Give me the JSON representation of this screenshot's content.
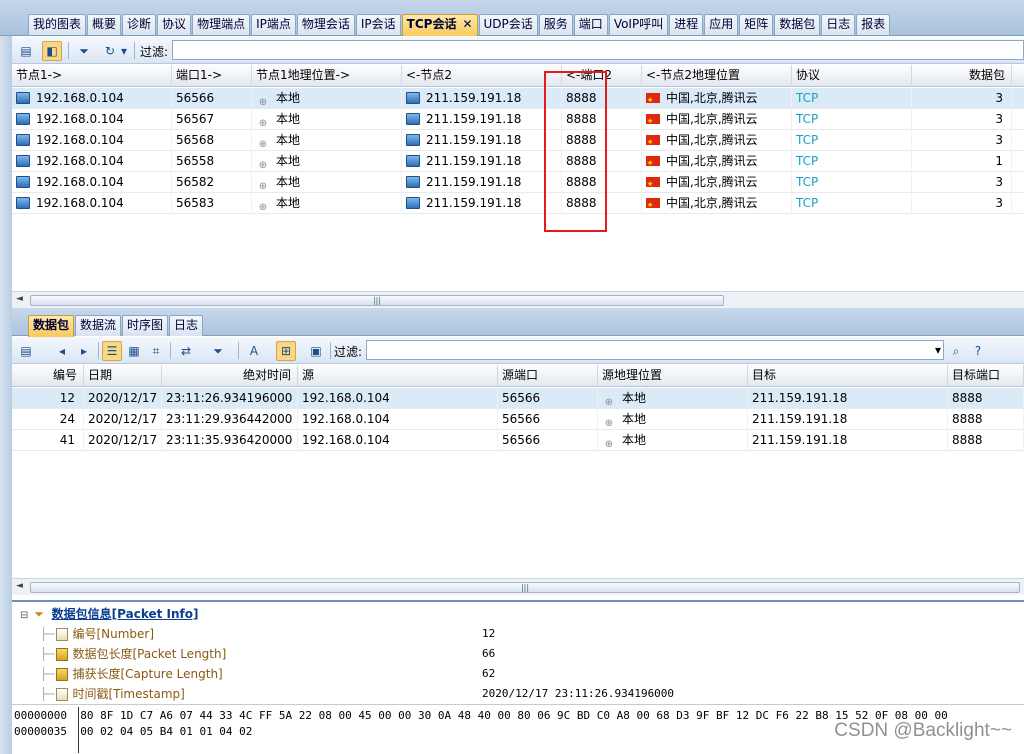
{
  "top_tabs": [
    "我的图表",
    "概要",
    "诊断",
    "协议",
    "物理端点",
    "IP端点",
    "物理会话",
    "IP会话",
    "TCP会话",
    "UDP会话",
    "服务",
    "端口",
    "VoIP呼叫",
    "进程",
    "应用",
    "矩阵",
    "数据包",
    "日志",
    "报表"
  ],
  "active_top_tab": "TCP会话",
  "close_glyph": "✕",
  "toolbar1": {
    "filter_label": "过滤:",
    "filter_value": ""
  },
  "sessions": {
    "headers": [
      "节点1->",
      "端口1->",
      "节点1地理位置->",
      "<-节点2",
      "<-端口2",
      "<-节点2地理位置",
      "协议",
      "数据包"
    ],
    "rows": [
      [
        "192.168.0.104",
        "56566",
        "本地",
        "211.159.191.18",
        "8888",
        "中国,北京,腾讯云",
        "TCP",
        "3"
      ],
      [
        "192.168.0.104",
        "56567",
        "本地",
        "211.159.191.18",
        "8888",
        "中国,北京,腾讯云",
        "TCP",
        "3"
      ],
      [
        "192.168.0.104",
        "56568",
        "本地",
        "211.159.191.18",
        "8888",
        "中国,北京,腾讯云",
        "TCP",
        "3"
      ],
      [
        "192.168.0.104",
        "56558",
        "本地",
        "211.159.191.18",
        "8888",
        "中国,北京,腾讯云",
        "TCP",
        "1"
      ],
      [
        "192.168.0.104",
        "56582",
        "本地",
        "211.159.191.18",
        "8888",
        "中国,北京,腾讯云",
        "TCP",
        "3"
      ],
      [
        "192.168.0.104",
        "56583",
        "本地",
        "211.159.191.18",
        "8888",
        "中国,北京,腾讯云",
        "TCP",
        "3"
      ]
    ]
  },
  "sub_tabs": [
    "数据包",
    "数据流",
    "时序图",
    "日志"
  ],
  "active_sub_tab": "数据包",
  "toolbar2": {
    "filter_label": "过滤:",
    "filter_value": ""
  },
  "packets": {
    "headers": [
      "编号",
      "日期",
      "绝对时间",
      "源",
      "源端口",
      "源地理位置",
      "目标",
      "目标端口"
    ],
    "rows": [
      [
        "12",
        "2020/12/17",
        "23:11:26.934196000",
        "192.168.0.104",
        "56566",
        "本地",
        "211.159.191.18",
        "8888"
      ],
      [
        "24",
        "2020/12/17",
        "23:11:29.936442000",
        "192.168.0.104",
        "56566",
        "本地",
        "211.159.191.18",
        "8888"
      ],
      [
        "41",
        "2020/12/17",
        "23:11:35.936420000",
        "192.168.0.104",
        "56566",
        "本地",
        "211.159.191.18",
        "8888"
      ]
    ]
  },
  "packet_info": {
    "title": "数据包信息[Packet Info]",
    "fields": [
      {
        "label": "编号[Number]",
        "value": "12"
      },
      {
        "label": "数据包长度[Packet Length]",
        "value": "66"
      },
      {
        "label": "捕获长度[Capture Length]",
        "value": "62"
      },
      {
        "label": "时间戳[Timestamp]",
        "value": "2020/12/17 23:11:26.934196000"
      }
    ]
  },
  "hex": {
    "lines": [
      {
        "offset": "00000000",
        "bytes": "80 8F 1D C7 A6 07 44 33 4C FF 5A 22 08 00 45 00 00 30 0A 48 40 00 80 06 9C BD C0 A8 00 68 D3 9F BF 12 DC F6 22 B8 15 52 0F 08 00 00"
      },
      {
        "offset": "00000035",
        "bytes": "00 02 04 05 B4 01 01 04 02"
      }
    ]
  },
  "watermark": "CSDN @Backlight~~",
  "colors": {
    "highlight_box": "#e31b1b",
    "protocol_text": "#1aa0c8",
    "active_tab": "#f8c95e"
  }
}
